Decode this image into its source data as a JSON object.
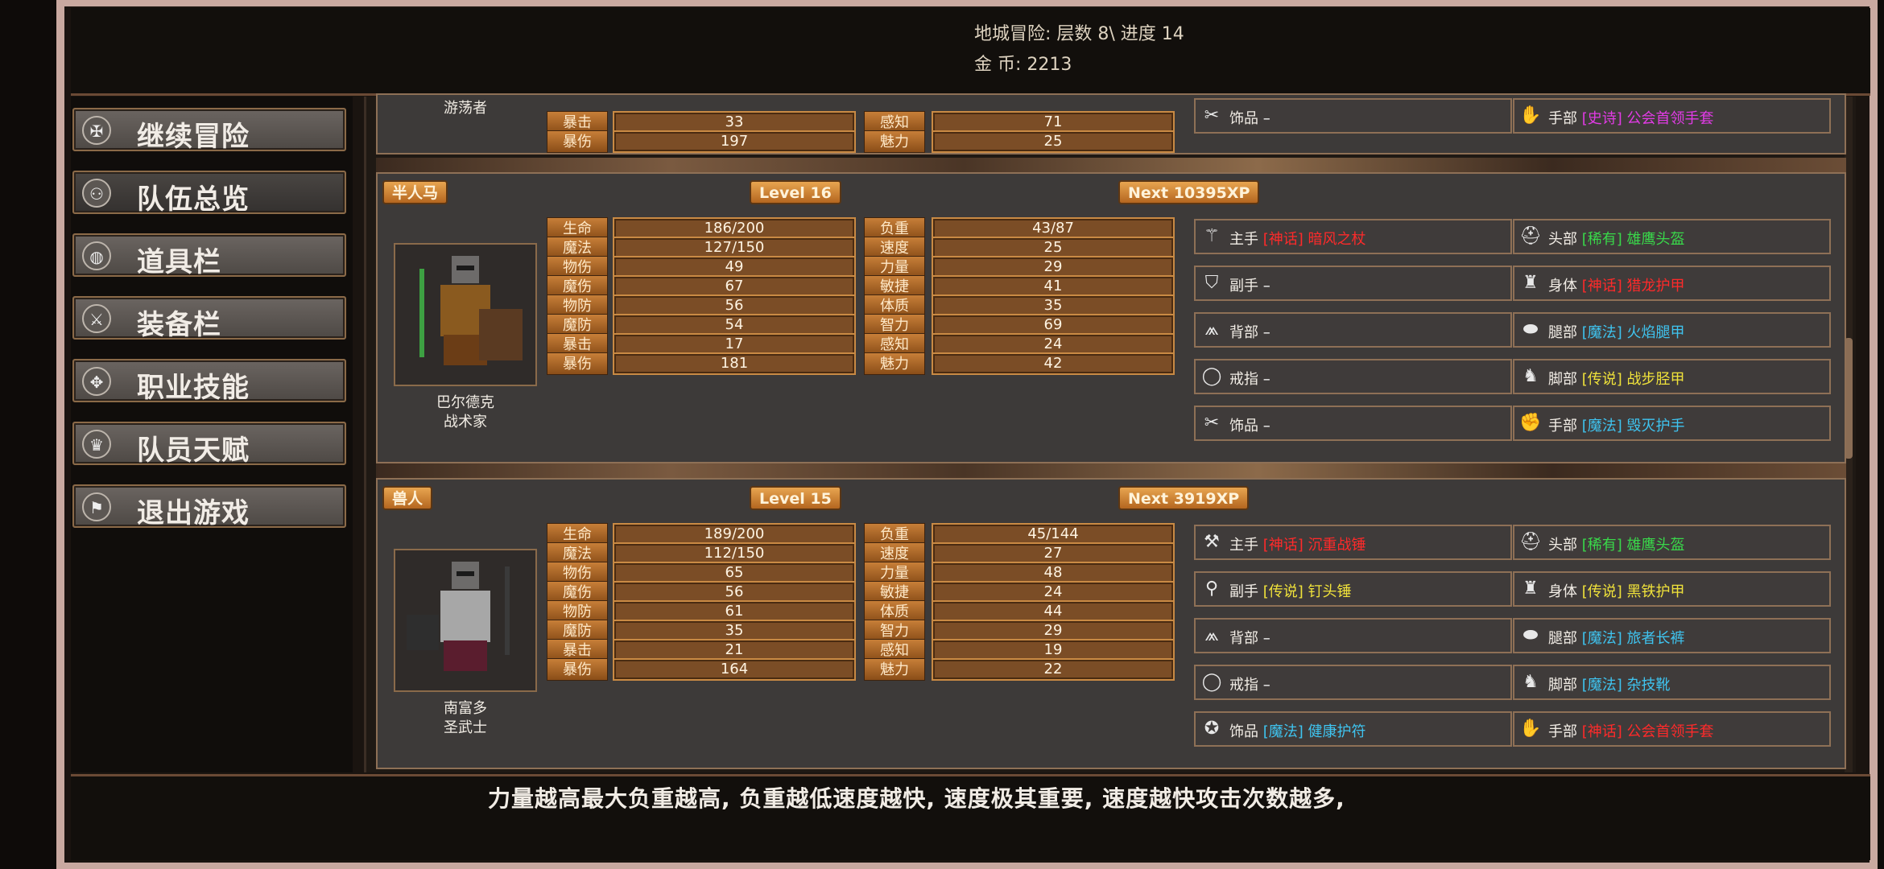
{
  "header": {
    "line1": "地城冒险: 层数 8\\ 进度 14",
    "line2": "金    币: 2213"
  },
  "menu": [
    {
      "label": "继续冒险",
      "icon": "dragon-icon"
    },
    {
      "label": "队伍总览",
      "icon": "party-icon"
    },
    {
      "label": "道具栏",
      "icon": "bag-icon"
    },
    {
      "label": "装备栏",
      "icon": "equipment-icon"
    },
    {
      "label": "职业技能",
      "icon": "wings-icon"
    },
    {
      "label": "队员天赋",
      "icon": "laurel-icon"
    },
    {
      "label": "退出游戏",
      "icon": "flag-icon"
    }
  ],
  "partial": {
    "name": "游荡者",
    "stats": [
      {
        "l": "暴击",
        "v": "33",
        "l2": "感知",
        "v2": "71"
      },
      {
        "l": "暴伤",
        "v": "197",
        "l2": "魅力",
        "v2": "25"
      }
    ],
    "slots": [
      {
        "name": "饰品",
        "rarity": "",
        "item": "–",
        "icon": "crossed-tools-icon"
      },
      {
        "name": "手部",
        "rarity": "[史诗]",
        "item": "公会首领手套",
        "color": "#e23be6",
        "icon": "glove-icon"
      }
    ]
  },
  "characters": [
    {
      "race": "半人马",
      "level": "Level 16",
      "next": "Next 10395XP",
      "name": "巴尔德克",
      "class": "战术家",
      "stats": [
        {
          "l": "生命",
          "v": "186/200",
          "l2": "负重",
          "v2": "43/87"
        },
        {
          "l": "魔法",
          "v": "127/150",
          "l2": "速度",
          "v2": "25"
        },
        {
          "l": "物伤",
          "v": "49",
          "l2": "力量",
          "v2": "29"
        },
        {
          "l": "魔伤",
          "v": "67",
          "l2": "敏捷",
          "v2": "41"
        },
        {
          "l": "物防",
          "v": "56",
          "l2": "体质",
          "v2": "35"
        },
        {
          "l": "魔防",
          "v": "54",
          "l2": "智力",
          "v2": "69"
        },
        {
          "l": "暴击",
          "v": "17",
          "l2": "感知",
          "v2": "24"
        },
        {
          "l": "暴伤",
          "v": "181",
          "l2": "魅力",
          "v2": "42"
        }
      ],
      "slots": [
        {
          "name": "主手",
          "rarity": "[神话]",
          "item": "暗风之杖",
          "color": "#ff2a2a",
          "icon": "staff-icon"
        },
        {
          "name": "头部",
          "rarity": "[稀有]",
          "item": "雄鹰头盔",
          "color": "#39d84a",
          "icon": "helmet-icon"
        },
        {
          "name": "副手",
          "rarity": "",
          "item": "–",
          "icon": "shield-icon"
        },
        {
          "name": "身体",
          "rarity": "[神话]",
          "item": "猎龙护甲",
          "color": "#ff2a2a",
          "icon": "armor-icon"
        },
        {
          "name": "背部",
          "rarity": "",
          "item": "–",
          "icon": "cape-icon"
        },
        {
          "name": "腿部",
          "rarity": "[魔法]",
          "item": "火焰腿甲",
          "color": "#3fc4f0",
          "icon": "greaves-icon"
        },
        {
          "name": "戒指",
          "rarity": "",
          "item": "–",
          "icon": "ring-icon"
        },
        {
          "name": "脚部",
          "rarity": "[传说]",
          "item": "战步胫甲",
          "color": "#f0e23a",
          "icon": "boots-icon"
        },
        {
          "name": "饰品",
          "rarity": "",
          "item": "–",
          "icon": "crossed-tools-icon"
        },
        {
          "name": "手部",
          "rarity": "[魔法]",
          "item": "毁灭护手",
          "color": "#3fc4f0",
          "icon": "gauntlet-icon"
        }
      ]
    },
    {
      "race": "兽人",
      "level": "Level 15",
      "next": "Next 3919XP",
      "name": "南富多",
      "class": "圣武士",
      "stats": [
        {
          "l": "生命",
          "v": "189/200",
          "l2": "负重",
          "v2": "45/144"
        },
        {
          "l": "魔法",
          "v": "112/150",
          "l2": "速度",
          "v2": "27"
        },
        {
          "l": "物伤",
          "v": "65",
          "l2": "力量",
          "v2": "48"
        },
        {
          "l": "魔伤",
          "v": "56",
          "l2": "敏捷",
          "v2": "24"
        },
        {
          "l": "物防",
          "v": "61",
          "l2": "体质",
          "v2": "44"
        },
        {
          "l": "魔防",
          "v": "35",
          "l2": "智力",
          "v2": "29"
        },
        {
          "l": "暴击",
          "v": "21",
          "l2": "感知",
          "v2": "19"
        },
        {
          "l": "暴伤",
          "v": "164",
          "l2": "魅力",
          "v2": "22"
        }
      ],
      "slots": [
        {
          "name": "主手",
          "rarity": "[神话]",
          "item": "沉重战锤",
          "color": "#ff2a2a",
          "icon": "warhammer-icon"
        },
        {
          "name": "头部",
          "rarity": "[稀有]",
          "item": "雄鹰头盔",
          "color": "#39d84a",
          "icon": "helmet-icon"
        },
        {
          "name": "副手",
          "rarity": "[传说]",
          "item": "钉头锤",
          "color": "#f0e23a",
          "icon": "mace-icon"
        },
        {
          "name": "身体",
          "rarity": "[传说]",
          "item": "黑铁护甲",
          "color": "#f0e23a",
          "icon": "armor-icon"
        },
        {
          "name": "背部",
          "rarity": "",
          "item": "–",
          "icon": "cape-icon"
        },
        {
          "name": "腿部",
          "rarity": "[魔法]",
          "item": "旅者长裤",
          "color": "#3fc4f0",
          "icon": "greaves-icon"
        },
        {
          "name": "戒指",
          "rarity": "",
          "item": "–",
          "icon": "ring-icon"
        },
        {
          "name": "脚部",
          "rarity": "[魔法]",
          "item": "杂技靴",
          "color": "#3fc4f0",
          "icon": "boots-icon"
        },
        {
          "name": "饰品",
          "rarity": "[魔法]",
          "item": "健康护符",
          "color": "#3fc4f0",
          "icon": "amulet-icon"
        },
        {
          "name": "手部",
          "rarity": "[神话]",
          "item": "公会首领手套",
          "color": "#ff2a2a",
          "icon": "glove-icon"
        }
      ]
    }
  ],
  "footer": {
    "tip": "力量越高最大负重越高, 负重越低速度越快, 速度极其重要, 速度越快攻击次数越多,"
  }
}
